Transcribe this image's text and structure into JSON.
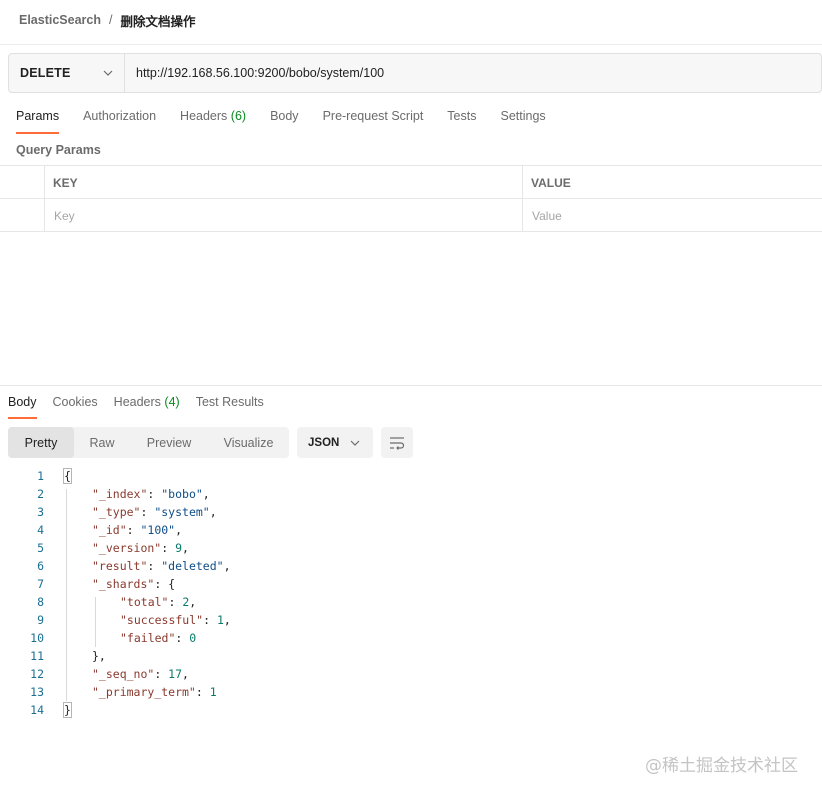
{
  "breadcrumb": {
    "parent": "ElasticSearch",
    "separator": "/",
    "current": "删除文档操作"
  },
  "request": {
    "method": "DELETE",
    "url": "http://192.168.56.100:9200/bobo/system/100"
  },
  "request_tabs": [
    {
      "label": "Params",
      "count": ""
    },
    {
      "label": "Authorization",
      "count": ""
    },
    {
      "label": "Headers",
      "count": "(6)"
    },
    {
      "label": "Body",
      "count": ""
    },
    {
      "label": "Pre-request Script",
      "count": ""
    },
    {
      "label": "Tests",
      "count": ""
    },
    {
      "label": "Settings",
      "count": ""
    }
  ],
  "active_request_tab": "Params",
  "query_params": {
    "title": "Query Params",
    "header_key": "KEY",
    "header_value": "VALUE",
    "placeholder_key": "Key",
    "placeholder_value": "Value"
  },
  "response_tabs": [
    {
      "label": "Body",
      "count": ""
    },
    {
      "label": "Cookies",
      "count": ""
    },
    {
      "label": "Headers",
      "count": "(4)"
    },
    {
      "label": "Test Results",
      "count": ""
    }
  ],
  "active_response_tab": "Body",
  "view_modes": [
    "Pretty",
    "Raw",
    "Preview",
    "Visualize"
  ],
  "active_view_mode": "Pretty",
  "format": "JSON",
  "accent_color": "#ff6c37",
  "count_color": "#0b8a1f",
  "response_lines": [
    {
      "n": "1",
      "indent": 0,
      "tokens": [
        [
          "p",
          "{"
        ]
      ]
    },
    {
      "n": "2",
      "indent": 1,
      "tokens": [
        [
          "k",
          "\"_index\""
        ],
        [
          "p",
          ": "
        ],
        [
          "s",
          "\"bobo\""
        ],
        [
          "p",
          ","
        ]
      ]
    },
    {
      "n": "3",
      "indent": 1,
      "tokens": [
        [
          "k",
          "\"_type\""
        ],
        [
          "p",
          ": "
        ],
        [
          "s",
          "\"system\""
        ],
        [
          "p",
          ","
        ]
      ]
    },
    {
      "n": "4",
      "indent": 1,
      "tokens": [
        [
          "k",
          "\"_id\""
        ],
        [
          "p",
          ": "
        ],
        [
          "s",
          "\"100\""
        ],
        [
          "p",
          ","
        ]
      ]
    },
    {
      "n": "5",
      "indent": 1,
      "tokens": [
        [
          "k",
          "\"_version\""
        ],
        [
          "p",
          ": "
        ],
        [
          "n",
          "9"
        ],
        [
          "p",
          ","
        ]
      ]
    },
    {
      "n": "6",
      "indent": 1,
      "tokens": [
        [
          "k",
          "\"result\""
        ],
        [
          "p",
          ": "
        ],
        [
          "s",
          "\"deleted\""
        ],
        [
          "p",
          ","
        ]
      ]
    },
    {
      "n": "7",
      "indent": 1,
      "tokens": [
        [
          "k",
          "\"_shards\""
        ],
        [
          "p",
          ": {"
        ]
      ]
    },
    {
      "n": "8",
      "indent": 2,
      "tokens": [
        [
          "k",
          "\"total\""
        ],
        [
          "p",
          ": "
        ],
        [
          "n",
          "2"
        ],
        [
          "p",
          ","
        ]
      ]
    },
    {
      "n": "9",
      "indent": 2,
      "tokens": [
        [
          "k",
          "\"successful\""
        ],
        [
          "p",
          ": "
        ],
        [
          "n",
          "1"
        ],
        [
          "p",
          ","
        ]
      ]
    },
    {
      "n": "10",
      "indent": 2,
      "tokens": [
        [
          "k",
          "\"failed\""
        ],
        [
          "p",
          ": "
        ],
        [
          "n",
          "0"
        ]
      ]
    },
    {
      "n": "11",
      "indent": 1,
      "tokens": [
        [
          "p",
          "},"
        ]
      ]
    },
    {
      "n": "12",
      "indent": 1,
      "tokens": [
        [
          "k",
          "\"_seq_no\""
        ],
        [
          "p",
          ": "
        ],
        [
          "n",
          "17"
        ],
        [
          "p",
          ","
        ]
      ]
    },
    {
      "n": "13",
      "indent": 1,
      "tokens": [
        [
          "k",
          "\"_primary_term\""
        ],
        [
          "p",
          ": "
        ],
        [
          "n",
          "1"
        ]
      ]
    },
    {
      "n": "14",
      "indent": 0,
      "tokens": [
        [
          "p",
          "}"
        ]
      ]
    }
  ],
  "watermark": "@稀土掘金技术社区",
  "icons": {
    "method_dropdown": "chevron-down-icon",
    "format_dropdown": "chevron-down-icon",
    "wrap": "wrap-lines-icon"
  }
}
